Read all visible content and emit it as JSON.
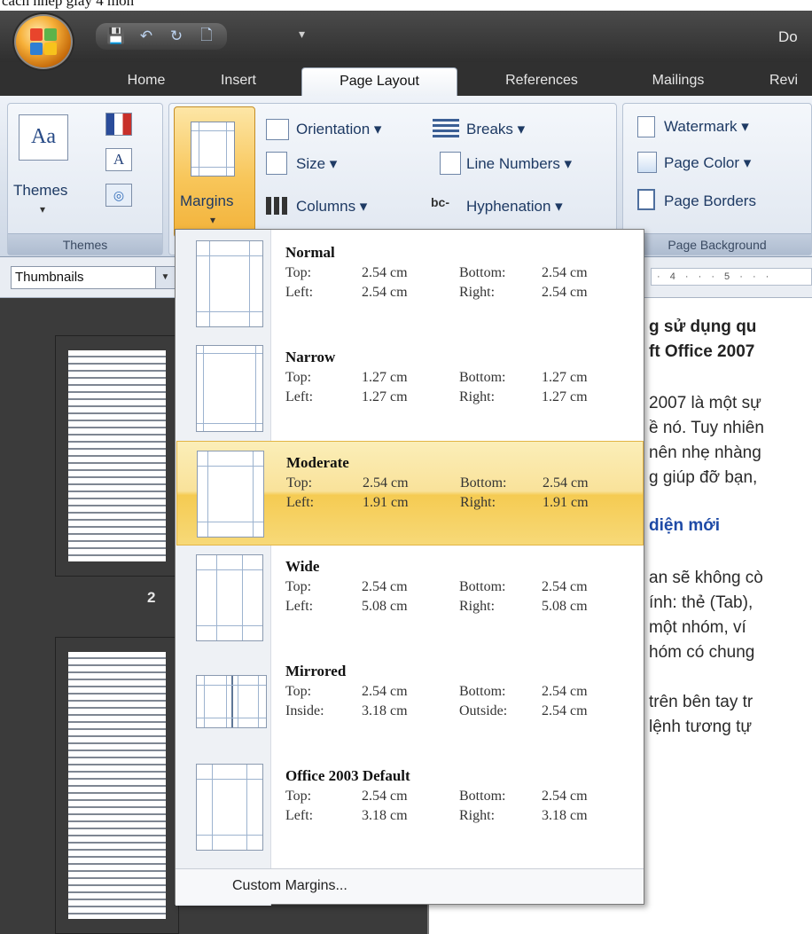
{
  "caption": "cach nhep giay 4 mon",
  "window": {
    "title": "Do"
  },
  "quick_access": [
    {
      "icon": "save-icon",
      "glyph": "💾"
    },
    {
      "icon": "undo-icon",
      "glyph": "↶"
    },
    {
      "icon": "redo-icon",
      "glyph": "↻"
    },
    {
      "icon": "print-preview-icon",
      "glyph": "🗋"
    }
  ],
  "tabs": [
    {
      "label": "Home"
    },
    {
      "label": "Insert"
    },
    {
      "label": "Page Layout",
      "active": true
    },
    {
      "label": "References"
    },
    {
      "label": "Mailings"
    },
    {
      "label": "Revi"
    }
  ],
  "ribbon": {
    "themes_group": {
      "label": "Themes",
      "themes_button": "Themes"
    },
    "page_setup": {
      "margins": "Margins",
      "orientation": "Orientation ▾",
      "size": "Size ▾",
      "columns": "Columns ▾",
      "breaks": "Breaks ▾",
      "line_numbers": "Line Numbers ▾",
      "hyphenation": "Hyphenation ▾"
    },
    "page_background": {
      "label": "Page Background",
      "watermark": "Watermark ▾",
      "page_color": "Page Color ▾",
      "page_borders": "Page Borders"
    }
  },
  "thumbnails": {
    "selector": "Thumbnails",
    "page_label": "2"
  },
  "ruler_text": "· 4 · · · 5 · · ·",
  "document_lines": [
    {
      "text": "g sử dụng qu",
      "style": "bold"
    },
    {
      "text": "ft Office 2007",
      "style": "bold"
    },
    {
      "text": "2007 là một sự",
      "style": "normal"
    },
    {
      "text": "ề nó. Tuy nhiên",
      "style": "normal"
    },
    {
      "text": "nên nhẹ nhàng",
      "style": "normal"
    },
    {
      "text": "g giúp đỡ bạn,",
      "style": "normal"
    },
    {
      "text": "diện mới",
      "style": "blue"
    },
    {
      "text": "an sẽ không cò",
      "style": "normal"
    },
    {
      "text": "ính: thẻ (Tab),",
      "style": "normal"
    },
    {
      "text": "một nhóm, ví",
      "style": "normal"
    },
    {
      "text": "hóm có chung",
      "style": "normal"
    },
    {
      "text": "trên bên tay tr",
      "style": "normal"
    },
    {
      "text": "lệnh tương tự",
      "style": "normal"
    }
  ],
  "margins_menu": {
    "options": [
      {
        "name": "Normal",
        "r1": [
          "Top:",
          "2.54 cm",
          "Bottom:",
          "2.54 cm"
        ],
        "r2": [
          "Left:",
          "2.54 cm",
          "Right:",
          "2.54 cm"
        ]
      },
      {
        "name": "Narrow",
        "r1": [
          "Top:",
          "1.27 cm",
          "Bottom:",
          "1.27 cm"
        ],
        "r2": [
          "Left:",
          "1.27 cm",
          "Right:",
          "1.27 cm"
        ]
      },
      {
        "name": "Moderate",
        "r1": [
          "Top:",
          "2.54 cm",
          "Bottom:",
          "2.54 cm"
        ],
        "r2": [
          "Left:",
          "1.91 cm",
          "Right:",
          "1.91 cm"
        ],
        "highlighted": true
      },
      {
        "name": "Wide",
        "r1": [
          "Top:",
          "2.54 cm",
          "Bottom:",
          "2.54 cm"
        ],
        "r2": [
          "Left:",
          "5.08 cm",
          "Right:",
          "5.08 cm"
        ]
      },
      {
        "name": "Mirrored",
        "r1": [
          "Top:",
          "2.54 cm",
          "Bottom:",
          "2.54 cm"
        ],
        "r2": [
          "Inside:",
          "3.18 cm",
          "Outside:",
          "2.54 cm"
        ]
      },
      {
        "name": "Office 2003 Default",
        "r1": [
          "Top:",
          "2.54 cm",
          "Bottom:",
          "2.54 cm"
        ],
        "r2": [
          "Left:",
          "3.18 cm",
          "Right:",
          "3.18 cm"
        ]
      }
    ],
    "custom": "Custom Margins..."
  },
  "colors": {
    "accent_highlight": "#f8c65a",
    "ribbon": "#dfe6f0",
    "link_blue": "#1e4aa6"
  }
}
